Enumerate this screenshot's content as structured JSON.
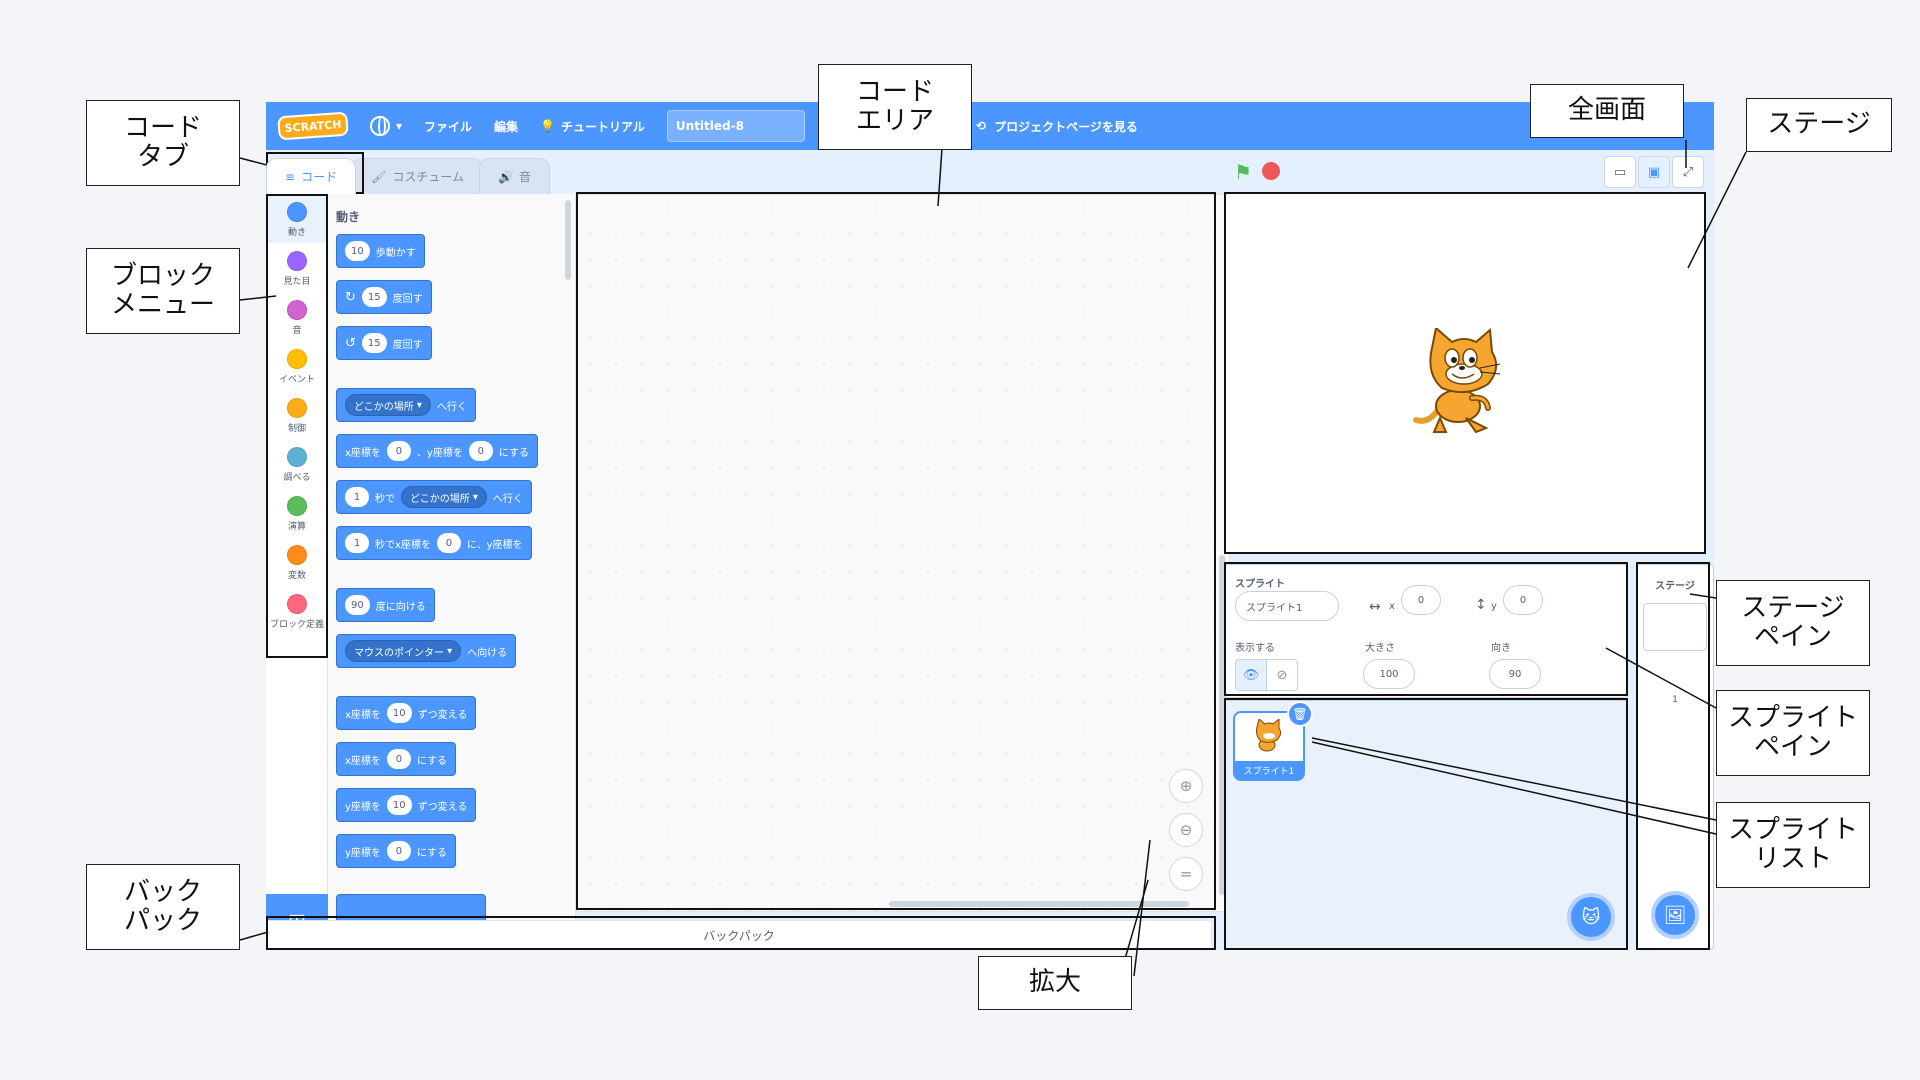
{
  "menubar": {
    "logo": "SCRATCH",
    "language_icon": "globe-icon",
    "file": "ファイル",
    "edit": "編集",
    "tutorial": "チュートリアル",
    "project_title": "Untitled-8",
    "project_page": "プロジェクトページを見る"
  },
  "tabs": {
    "code": "コード",
    "costumes": "コスチューム",
    "sounds": "音"
  },
  "categories": [
    {
      "label": "動き",
      "color": "#4c97ff"
    },
    {
      "label": "見た目",
      "color": "#9966ff"
    },
    {
      "label": "音",
      "color": "#cf63cf"
    },
    {
      "label": "イベント",
      "color": "#ffbf00"
    },
    {
      "label": "制御",
      "color": "#ffab19"
    },
    {
      "label": "調べる",
      "color": "#5cb1d6"
    },
    {
      "label": "演算",
      "color": "#59c059"
    },
    {
      "label": "変数",
      "color": "#ff8c1a"
    },
    {
      "label": "ブロック定義",
      "color": "#ff6680"
    }
  ],
  "palette": {
    "heading": "動き",
    "blocks": {
      "move": {
        "num": "10",
        "text": "歩動かす"
      },
      "turn_right": {
        "num": "15",
        "text": "度回す"
      },
      "turn_left": {
        "num": "15",
        "text": "度回す"
      },
      "goto": {
        "dd": "どこかの場所",
        "text": "へ行く"
      },
      "goto_xy": {
        "a": "x座標を",
        "x": "0",
        "b": "、y座標を",
        "y": "0",
        "c": "にする"
      },
      "glide": {
        "num": "1",
        "a": "秒で",
        "dd": "どこかの場所",
        "b": "へ行く"
      },
      "glide_xy": {
        "num": "1",
        "a": "秒でx座標を",
        "x": "0",
        "b": "に、y座標を"
      },
      "point_dir": {
        "num": "90",
        "text": "度に向ける"
      },
      "point_towards": {
        "dd": "マウスのポインター",
        "text": "へ向ける"
      },
      "change_x": {
        "a": "x座標を",
        "num": "10",
        "b": "ずつ変える"
      },
      "set_x": {
        "a": "x座標を",
        "num": "0",
        "b": "にする"
      },
      "change_y": {
        "a": "y座標を",
        "num": "10",
        "b": "ずつ変える"
      },
      "set_y": {
        "a": "y座標を",
        "num": "0",
        "b": "にする"
      }
    }
  },
  "backpack": "バックパック",
  "sprite_info": {
    "sprite_label": "スプライト",
    "sprite_name": "スプライト1",
    "x_label": "x",
    "x": "0",
    "y_label": "y",
    "y": "0",
    "show_label": "表示する",
    "size_label": "大きさ",
    "size": "100",
    "direction_label": "向き",
    "direction": "90"
  },
  "sprite_list": {
    "items": [
      {
        "name": "スプライト1"
      }
    ]
  },
  "stage_pane": {
    "title": "ステージ",
    "backdrop_count": "1"
  },
  "callouts": {
    "code_tab": "コード\nタブ",
    "block_menu": "ブロック\nメニュー",
    "backpack": "バック\nパック",
    "code_area": "コード\nエリア",
    "zoom": "拡大",
    "fullscreen": "全画面",
    "stage": "ステージ",
    "stage_pane": "ステージ\nペイン",
    "sprite_pane": "スプライト\nペイン",
    "sprite_list": "スプライト\nリスト"
  }
}
